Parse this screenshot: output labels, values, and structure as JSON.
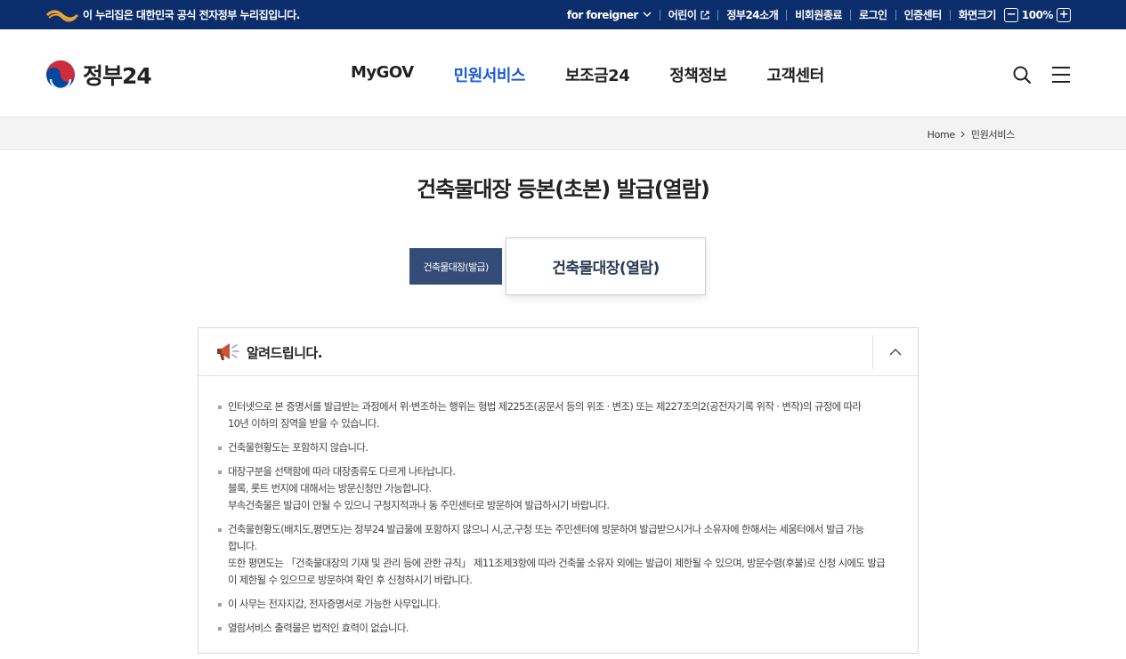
{
  "topbar": {
    "gov_notice": "이 누리집은 대한민국 공식 전자정부 누리집입니다.",
    "foreigner": "for foreigner",
    "kids": "어린이",
    "about": "정부24소개",
    "logout_nonmember": "비회원종료",
    "login": "로그인",
    "cert_center": "인증센터",
    "screen_size": "화면크기",
    "zoom_minus": "−",
    "zoom_value": "100%",
    "zoom_plus": "+"
  },
  "header": {
    "logo_text": "정부24",
    "menu": [
      "MyGOV",
      "민원서비스",
      "보조금24",
      "정책정보",
      "고객센터"
    ],
    "active_menu": "민원서비스",
    "icons": [
      "search-icon",
      "hamburger-menu-icon"
    ]
  },
  "breadcrumb": {
    "home": "Home",
    "current": "민원서비스"
  },
  "page": {
    "title": "건축물대장 등본(초본) 발급(열람)"
  },
  "tabs": [
    {
      "label": "건축물대장(발급)",
      "selected": false
    },
    {
      "label": "건축물대장(열람)",
      "selected": true
    }
  ],
  "notice": {
    "title": "알려드립니다.",
    "items": [
      [
        "인터넷으로 본 증명서를 발급받는 과정에서 위·변조하는 행위는 형법 제225조(공문서 등의 위조 · 변조) 또는 제227조의2(공전자기록 위작 · 변작)의 규정에 따라",
        "10년 이하의 징역을 받을 수 있습니다."
      ],
      [
        "건축물현황도는 포함하지 않습니다."
      ],
      [
        "대장구분을 선택함에 따라 대장종류도 다르게 나타납니다.",
        "블록, 롯트 번지에 대해서는 방문신청만 가능합니다.",
        "부속건축물은 발급이 안될 수 있으니 구청지적과나 동 주민센터로 방문하여 발급하시기 바랍니다."
      ],
      [
        "건축물현황도(배치도,평면도)는 정부24 발급물에 포함하지 않으니 시,군,구청 또는 주민센터에 방문하여 발급받으시거나 소유자에 한해서는 세움터에서 발급 가능",
        "합니다.",
        "또한 평면도는 「건축물대장의 기재 및 관리 등에 관한 규칙」 제11조제3항에 따라 건축물 소유자 외에는 발급이 제한될 수 있으며, 방문수령(후불)로 신청 시에도 발급",
        "이 제한될 수 있으므로 방문하여 확인 후 신청하시기 바랍니다."
      ],
      [
        "이 사무는 전자지갑, 전자증명서로 가능한 사무입니다."
      ],
      [
        "열람서비스 출력물은 법적인 효력이 없습니다."
      ]
    ]
  },
  "colors": {
    "topbar_bg": "#0b2d6b",
    "active_menu": "#1a5bd8",
    "tab_dark": "#334d78",
    "emblem_red": "#cd2e3a",
    "emblem_blue": "#0047a0"
  }
}
